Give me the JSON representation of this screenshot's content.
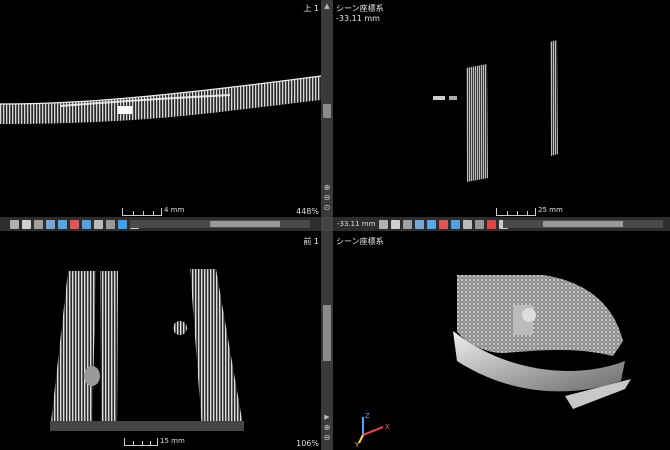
{
  "views": {
    "top_left": {
      "label": "上 1",
      "zoom": "448%",
      "scale": "4 mm"
    },
    "top_right": {
      "label": "シーン座標系",
      "offset": "-33.11 mm",
      "scale": "25 mm"
    },
    "bottom_left": {
      "label": "前 1",
      "zoom": "106%",
      "scale": "15 mm"
    },
    "bottom_right": {
      "label": "シーン座標系"
    }
  },
  "toolbar": {
    "right_offset": "-33.11 mm"
  },
  "axes": {
    "x": "X",
    "y": "Y",
    "z": "Z"
  },
  "icons": [
    "hand-icon",
    "rotate-icon",
    "pan-icon",
    "measure-icon",
    "axis-icon",
    "light-icon",
    "palette-icon",
    "grid-icon",
    "arrow-icon",
    "settings-icon",
    "play-icon"
  ]
}
